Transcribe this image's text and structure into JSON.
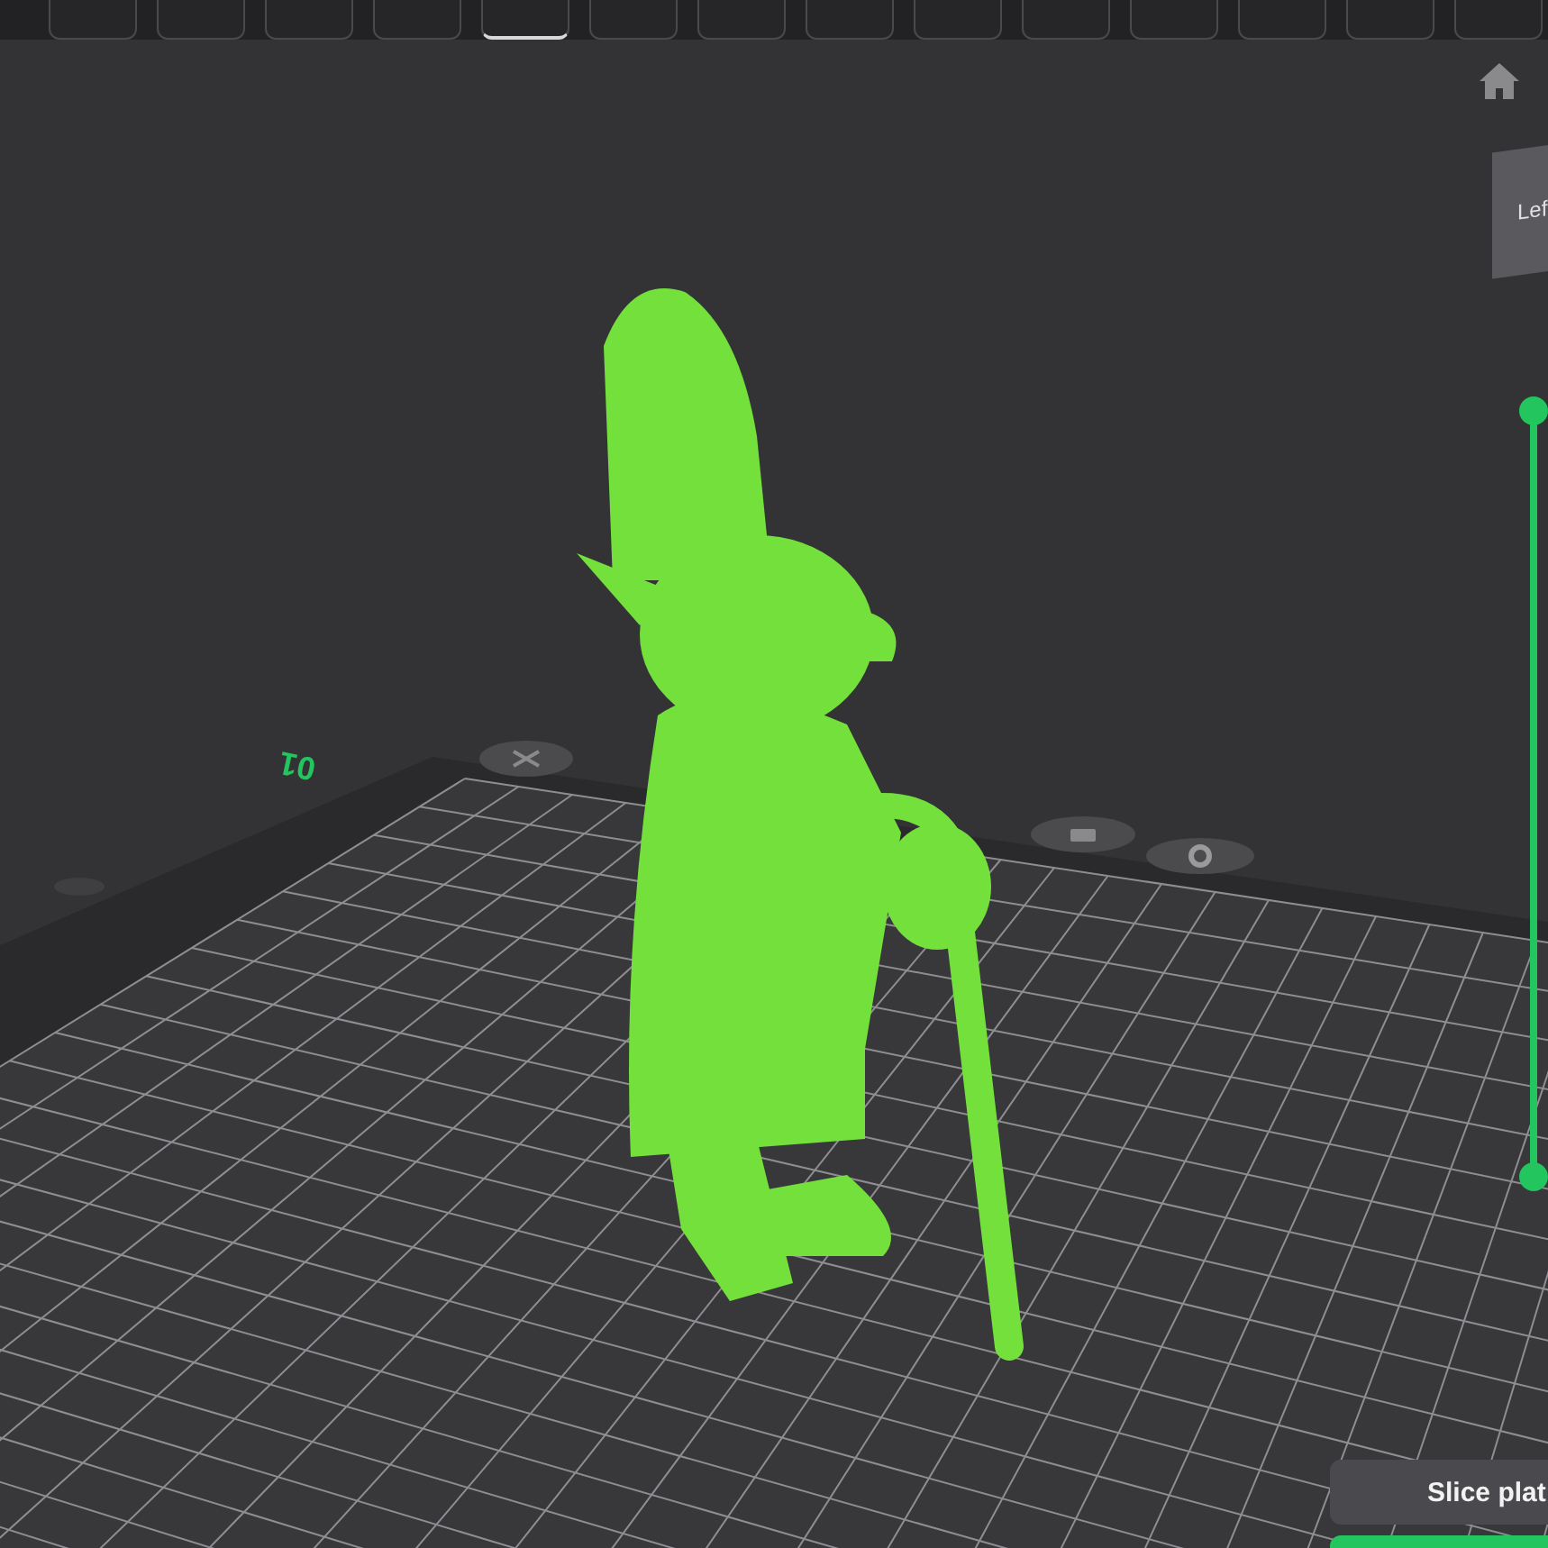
{
  "toolbar": {
    "items": [
      {
        "selected": false
      },
      {
        "selected": false
      },
      {
        "selected": false
      },
      {
        "selected": false
      },
      {
        "selected": true
      },
      {
        "selected": false
      },
      {
        "selected": false
      },
      {
        "selected": false
      },
      {
        "selected": false
      },
      {
        "selected": false
      },
      {
        "selected": false
      },
      {
        "selected": false
      },
      {
        "selected": false
      },
      {
        "selected": false
      }
    ]
  },
  "layer_slider": {
    "handles": [
      {
        "level": 1
      },
      {
        "level": 0
      }
    ]
  },
  "viewport": {
    "plate_label": "01",
    "view_cube": {
      "label": "Lef"
    },
    "slice_button": {
      "label": "Slice plat"
    }
  }
}
